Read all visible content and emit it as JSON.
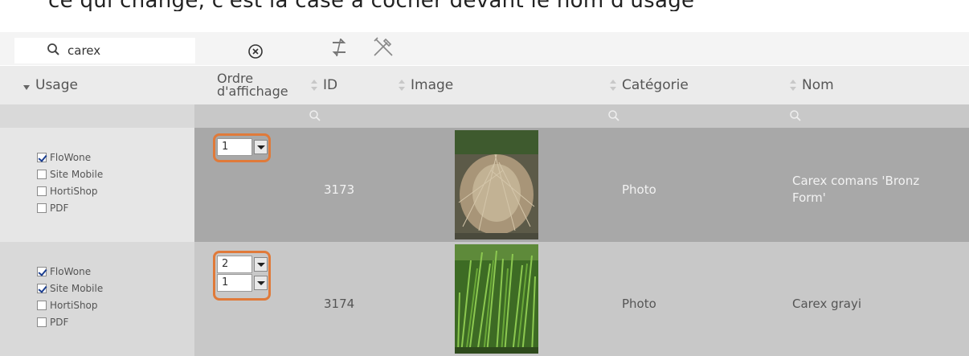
{
  "page_top_text": "ce qui change, c'est la case à cocher devant le nom d'usage",
  "search": {
    "value": "carex",
    "icon": "search-icon"
  },
  "toolbar": {
    "clear_icon": "clear-circle-icon",
    "sync_icon": "sync-arrows-icon",
    "tools_icon": "tools-icon"
  },
  "columns": {
    "usage": "Usage",
    "order_line1": "Ordre",
    "order_line2": "d'affichage",
    "id": "ID",
    "image": "Image",
    "category": "Catégorie",
    "name": "Nom"
  },
  "rows": [
    {
      "usages": [
        {
          "label": "FloWone",
          "checked": true
        },
        {
          "label": "Site Mobile",
          "checked": false
        },
        {
          "label": "HortiShop",
          "checked": false
        },
        {
          "label": "PDF",
          "checked": false
        }
      ],
      "orders": [
        "1"
      ],
      "id": "3173",
      "category": "Photo",
      "name_line1": "Carex comans 'Bronz",
      "name_line2": "Form'"
    },
    {
      "usages": [
        {
          "label": "FloWone",
          "checked": true
        },
        {
          "label": "Site Mobile",
          "checked": true
        },
        {
          "label": "HortiShop",
          "checked": false
        },
        {
          "label": "PDF",
          "checked": false
        }
      ],
      "orders": [
        "2",
        "1"
      ],
      "id": "3174",
      "category": "Photo",
      "name_line1": "Carex grayi",
      "name_line2": ""
    }
  ],
  "colors": {
    "highlight": "#e07a3a",
    "row_dark": "#a8a8a8",
    "row_light": "#c8c8c8"
  }
}
